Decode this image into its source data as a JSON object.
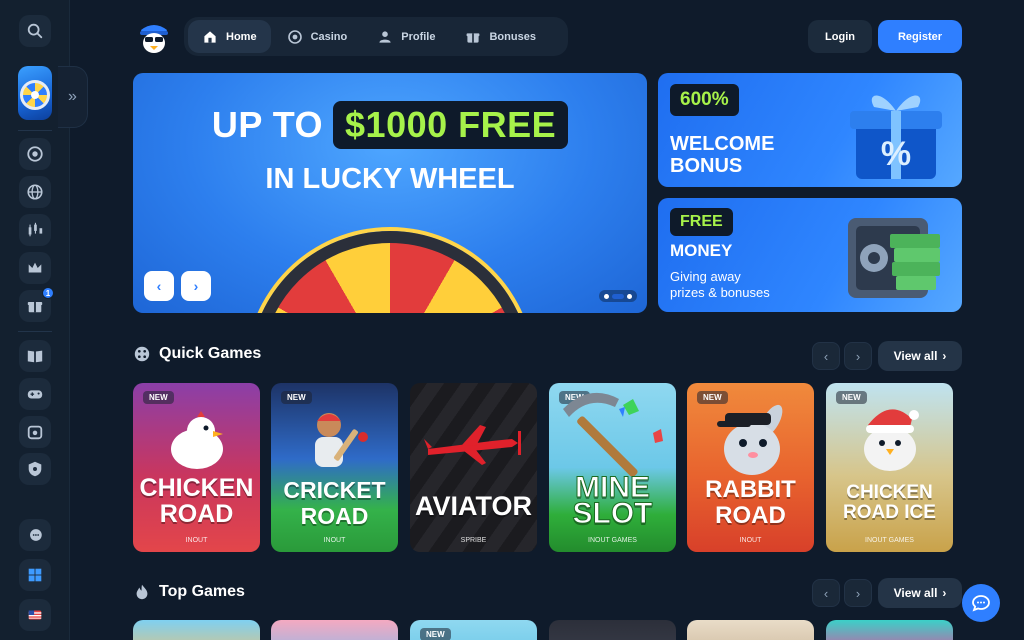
{
  "nav": {
    "items": [
      {
        "label": "Home",
        "icon": "home-icon",
        "active": true
      },
      {
        "label": "Casino",
        "icon": "chip-icon",
        "active": false
      },
      {
        "label": "Profile",
        "icon": "user-icon",
        "active": false
      },
      {
        "label": "Bonuses",
        "icon": "gift-icon",
        "active": false
      }
    ],
    "login_label": "Login",
    "register_label": "Register"
  },
  "sidebar": {
    "badge_count": "1",
    "expand_icon": "»"
  },
  "hero": {
    "line1_prefix": "UP TO",
    "line1_amount": "$1000 FREE",
    "line2": "IN LUCKY WHEEL",
    "prev": "‹",
    "next": "›"
  },
  "promos": [
    {
      "tag": "600%",
      "title_line1": "WELCOME",
      "title_line2": "BONUS"
    },
    {
      "tag": "FREE",
      "title": "MONEY",
      "sub_line1": "Giving away",
      "sub_line2": "prizes & bonuses"
    }
  ],
  "quick_games": {
    "title": "Quick Games",
    "view_all": "View all",
    "cards": [
      {
        "name_line1": "CHICKEN",
        "name_line2": "ROAD",
        "provider": "INOUT",
        "is_new": true,
        "tag": "NEW"
      },
      {
        "name_line1": "CRICKET",
        "name_line2": "ROAD",
        "provider": "INOUT",
        "is_new": true,
        "tag": "NEW"
      },
      {
        "name_line1": "AVIATOR",
        "name_line2": "",
        "provider": "SPRIBE",
        "is_new": false,
        "tag": ""
      },
      {
        "name_line1": "MINE",
        "name_line2": "SLOT",
        "provider": "INOUT GAMES",
        "is_new": true,
        "tag": "NEW"
      },
      {
        "name_line1": "RABBIT",
        "name_line2": "ROAD",
        "provider": "INOUT",
        "is_new": true,
        "tag": "NEW"
      },
      {
        "name_line1": "CHICKEN",
        "name_line2": "ROAD ICE",
        "provider": "INOUT GAMES",
        "is_new": true,
        "tag": "NEW"
      }
    ]
  },
  "top_games": {
    "title": "Top Games",
    "view_all": "View all",
    "new_tag": "NEW"
  },
  "colors": {
    "accent": "#2f7fff",
    "highlight": "#a6f24a",
    "background": "#0f1b2b"
  }
}
